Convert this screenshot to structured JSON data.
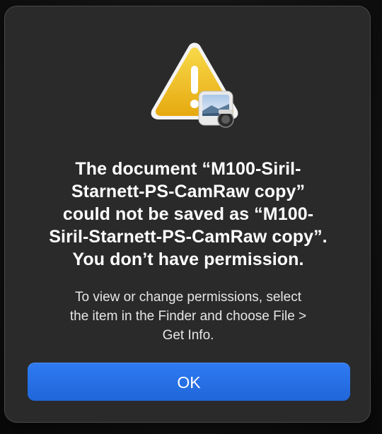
{
  "dialog": {
    "icon": "warning-caution-icon",
    "badge_icon": "preview-app-icon",
    "message_lines": [
      "The document “M100-Siril-",
      "Starnett-PS-CamRaw copy”",
      "could not be saved as “M100-",
      "Siril-Starnett-PS-CamRaw copy”.",
      "You don’t have permission."
    ],
    "info_lines": [
      "To view or change permissions, select",
      "the item in the Finder and choose File >",
      "Get Info."
    ],
    "ok_label": "OK"
  },
  "colors": {
    "dialog_background": "#2a2a2b",
    "button_accent": "#2370e6",
    "warning_yellow": "#f2c21b"
  }
}
